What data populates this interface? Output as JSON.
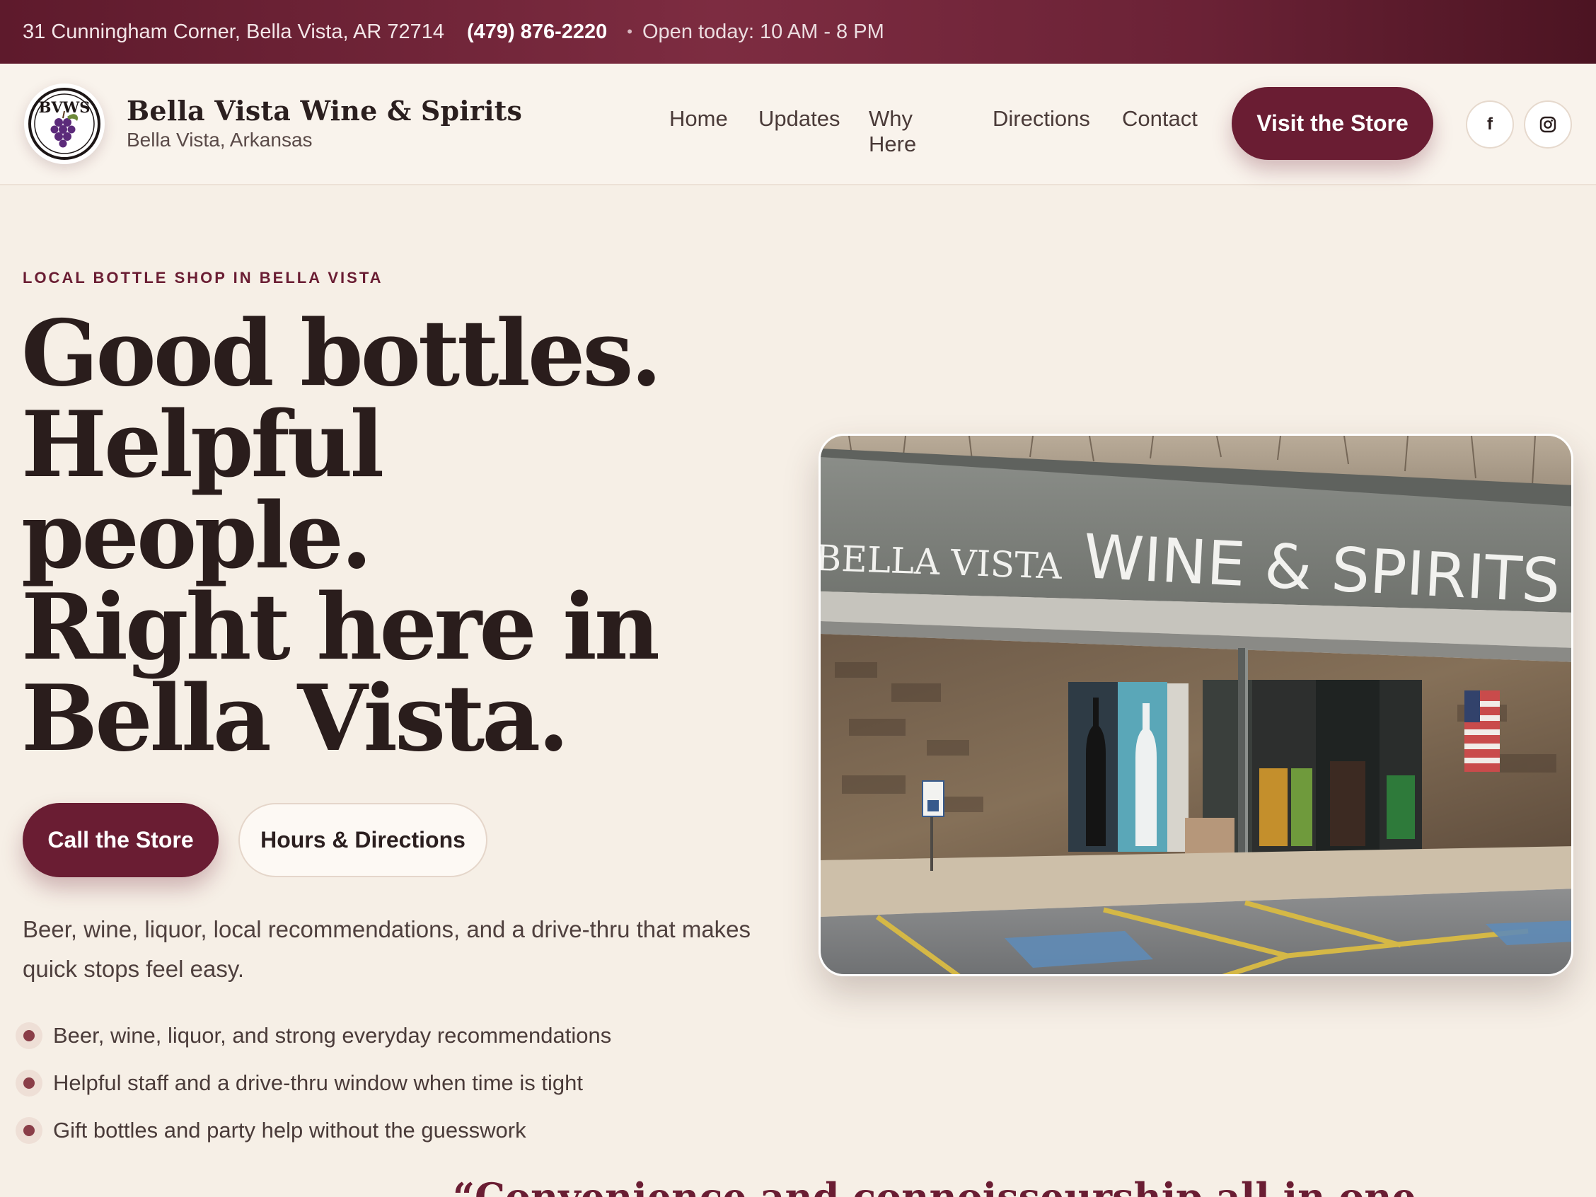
{
  "topbar": {
    "address": "31 Cunningham Corner, Bella Vista, AR 72714",
    "phone": "(479) 876-2220",
    "separator": "•",
    "hours": "Open today: 10 AM - 8 PM"
  },
  "header": {
    "logo_text": "BVWS",
    "brand_name": "Bella Vista Wine & Spirits",
    "brand_location": "Bella Vista, Arkansas",
    "nav": [
      {
        "label": "Home"
      },
      {
        "label": "Updates"
      },
      {
        "label": "Why Here"
      },
      {
        "label": "Directions"
      },
      {
        "label": "Contact"
      }
    ],
    "cta_label": "Visit the Store",
    "social": [
      {
        "icon": "facebook-icon",
        "glyph": "f"
      },
      {
        "icon": "instagram-icon"
      }
    ]
  },
  "hero": {
    "eyebrow": "LOCAL BOTTLE SHOP IN BELLA VISTA",
    "headline_lines": [
      "Good bottles.",
      "Helpful",
      "people.",
      "Right here in",
      "Bella Vista."
    ],
    "primary_button": "Call the Store",
    "secondary_button": "Hours & Directions",
    "lead": "Beer, wine, liquor, local recommendations, and a drive-thru that makes quick stops feel easy.",
    "bullets": [
      "Beer, wine, liquor, and strong everyday recommendations",
      "Helpful staff and a drive-thru window when time is tight",
      "Gift bottles and party help without the guesswork"
    ]
  },
  "storefront_photo": {
    "sign_left": "BELLA VISTA",
    "sign_right": "WINE & SPIRITS"
  },
  "quote_text": "“Convenience and connoisseurship all in one",
  "colors": {
    "brand": "#6a1d33",
    "background": "#f6efe6",
    "text": "#2b1f1f"
  }
}
